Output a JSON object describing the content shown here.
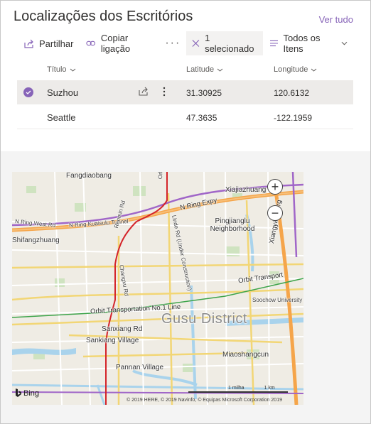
{
  "header": {
    "title": "Localizações dos Escritórios",
    "see_all": "Ver tudo"
  },
  "commandbar": {
    "share": "Partilhar",
    "copy_link": "Copiar ligação",
    "more": "···",
    "selected": "1 selecionado",
    "view": "Todos os Itens"
  },
  "columns": {
    "title": "Título",
    "latitude": "Latitude",
    "longitude": "Longitude"
  },
  "rows": [
    {
      "title": "Suzhou",
      "latitude": "31.30925",
      "longitude": "120.6132",
      "selected": true
    },
    {
      "title": "Seattle",
      "latitude": "47.3635",
      "longitude": "-122.1959",
      "selected": false
    }
  ],
  "map": {
    "labels": {
      "fangdiaobang": "Fangdiaobang",
      "xiajiazhuang": "Xiajiazhuang",
      "n_ring_expy": "N Ring Expy",
      "n_ring_west_rd": "N Ring West Rd",
      "n_ring_kuaisulu": "N Ring Kuaisulu Tunnel",
      "shifangzhuang": "Shifangzhuang",
      "pingjianglu": "Pingjianglu Neighborhood",
      "xiangyang_brg": "Xiangyang Brg",
      "orbit_transport": "Orbit Transport",
      "orbit_transport_no1": "Orbit Transportation No.1 Line",
      "gusu_district": "Gusu District",
      "soochow_university": "Soochow University",
      "sanxiang_rd": "Sanxiang Rd",
      "sankiang_village": "Sankiang Village",
      "miaoshangcun": "Miaoshangcun",
      "pannan_village": "Pannan Village",
      "changxu_rd": "Changxu Rd",
      "renmin_rd": "Renmin Rd",
      "linde_rd": "Linde Rd (Under Construction)",
      "orbit_left": "Orbit"
    },
    "zoom_in": "+",
    "zoom_out": "−",
    "bing": "Bing",
    "scale_miles": "1 milha",
    "scale_km": "1 km",
    "copyright": "© 2019 HERE, © 2019 Navinfo, © Equipas Microsoft Corporation 2019"
  }
}
